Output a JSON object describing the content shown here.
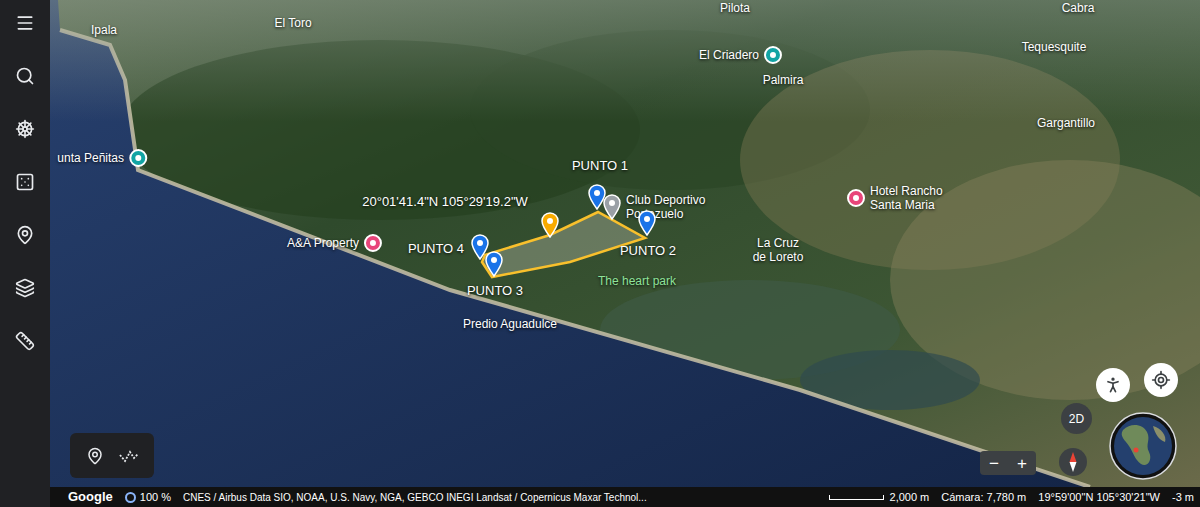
{
  "map": {
    "places": [
      {
        "lines": [
          "Pilota"
        ],
        "kind": "town"
      },
      {
        "lines": [
          "Cabra"
        ],
        "kind": "town"
      },
      {
        "lines": [
          "Ipala"
        ],
        "kind": "town"
      },
      {
        "lines": [
          "El Toro"
        ],
        "kind": "town"
      },
      {
        "lines": [
          "El Criadero"
        ],
        "kind": "poi",
        "color": "#12a4a4"
      },
      {
        "lines": [
          "Palmira"
        ],
        "kind": "town"
      },
      {
        "lines": [
          "Tequesquite"
        ],
        "kind": "town"
      },
      {
        "lines": [
          "Gargantillo"
        ],
        "kind": "town"
      },
      {
        "lines": [
          "unta Peñitas"
        ],
        "kind": "poi",
        "color": "#12a4a4"
      },
      {
        "lines": [
          "Club Deportivo",
          "Portezuelo"
        ],
        "kind": "pin",
        "color": "#9aa0a6"
      },
      {
        "lines": [
          "Hotel Rancho",
          "Santa Maria"
        ],
        "kind": "poi",
        "color": "#e8457a"
      },
      {
        "lines": [
          "La Cruz",
          "de Loreto"
        ],
        "kind": "town"
      },
      {
        "lines": [
          "A&A Property"
        ],
        "kind": "poi",
        "color": "#e8457a"
      },
      {
        "lines": [
          "Predio Aguadulce"
        ],
        "kind": "town"
      },
      {
        "lines": [
          "The heart park"
        ],
        "kind": "park"
      }
    ],
    "pins": [
      {
        "label": "PUNTO 1",
        "color": "#1a73e8"
      },
      {
        "label": "PUNTO 2",
        "color": "#1a73e8"
      },
      {
        "label": "PUNTO 3",
        "color": "#1a73e8"
      },
      {
        "label": "PUNTO 4",
        "color": "#1a73e8"
      },
      {
        "label": "20°01'41.4\"N 105°29'19.2\"W",
        "color": "#f9ab00"
      }
    ]
  },
  "controls": {
    "view_toggle": "2D",
    "zoom_out": "−",
    "zoom_in": "+"
  },
  "status_bar": {
    "logo": "Google",
    "zoom_level": "100 %",
    "attribution": "CNES / Airbus Data SIO, NOAA, U.S. Navy, NGA, GEBCO INEGI Landsat / Copernicus Maxar Technol...",
    "scale": "2,000 m",
    "camera": "Cámara: 7,780 m",
    "coordinates": "19°59'00\"N 105°30'21\"W",
    "elevation": "-3 m"
  }
}
